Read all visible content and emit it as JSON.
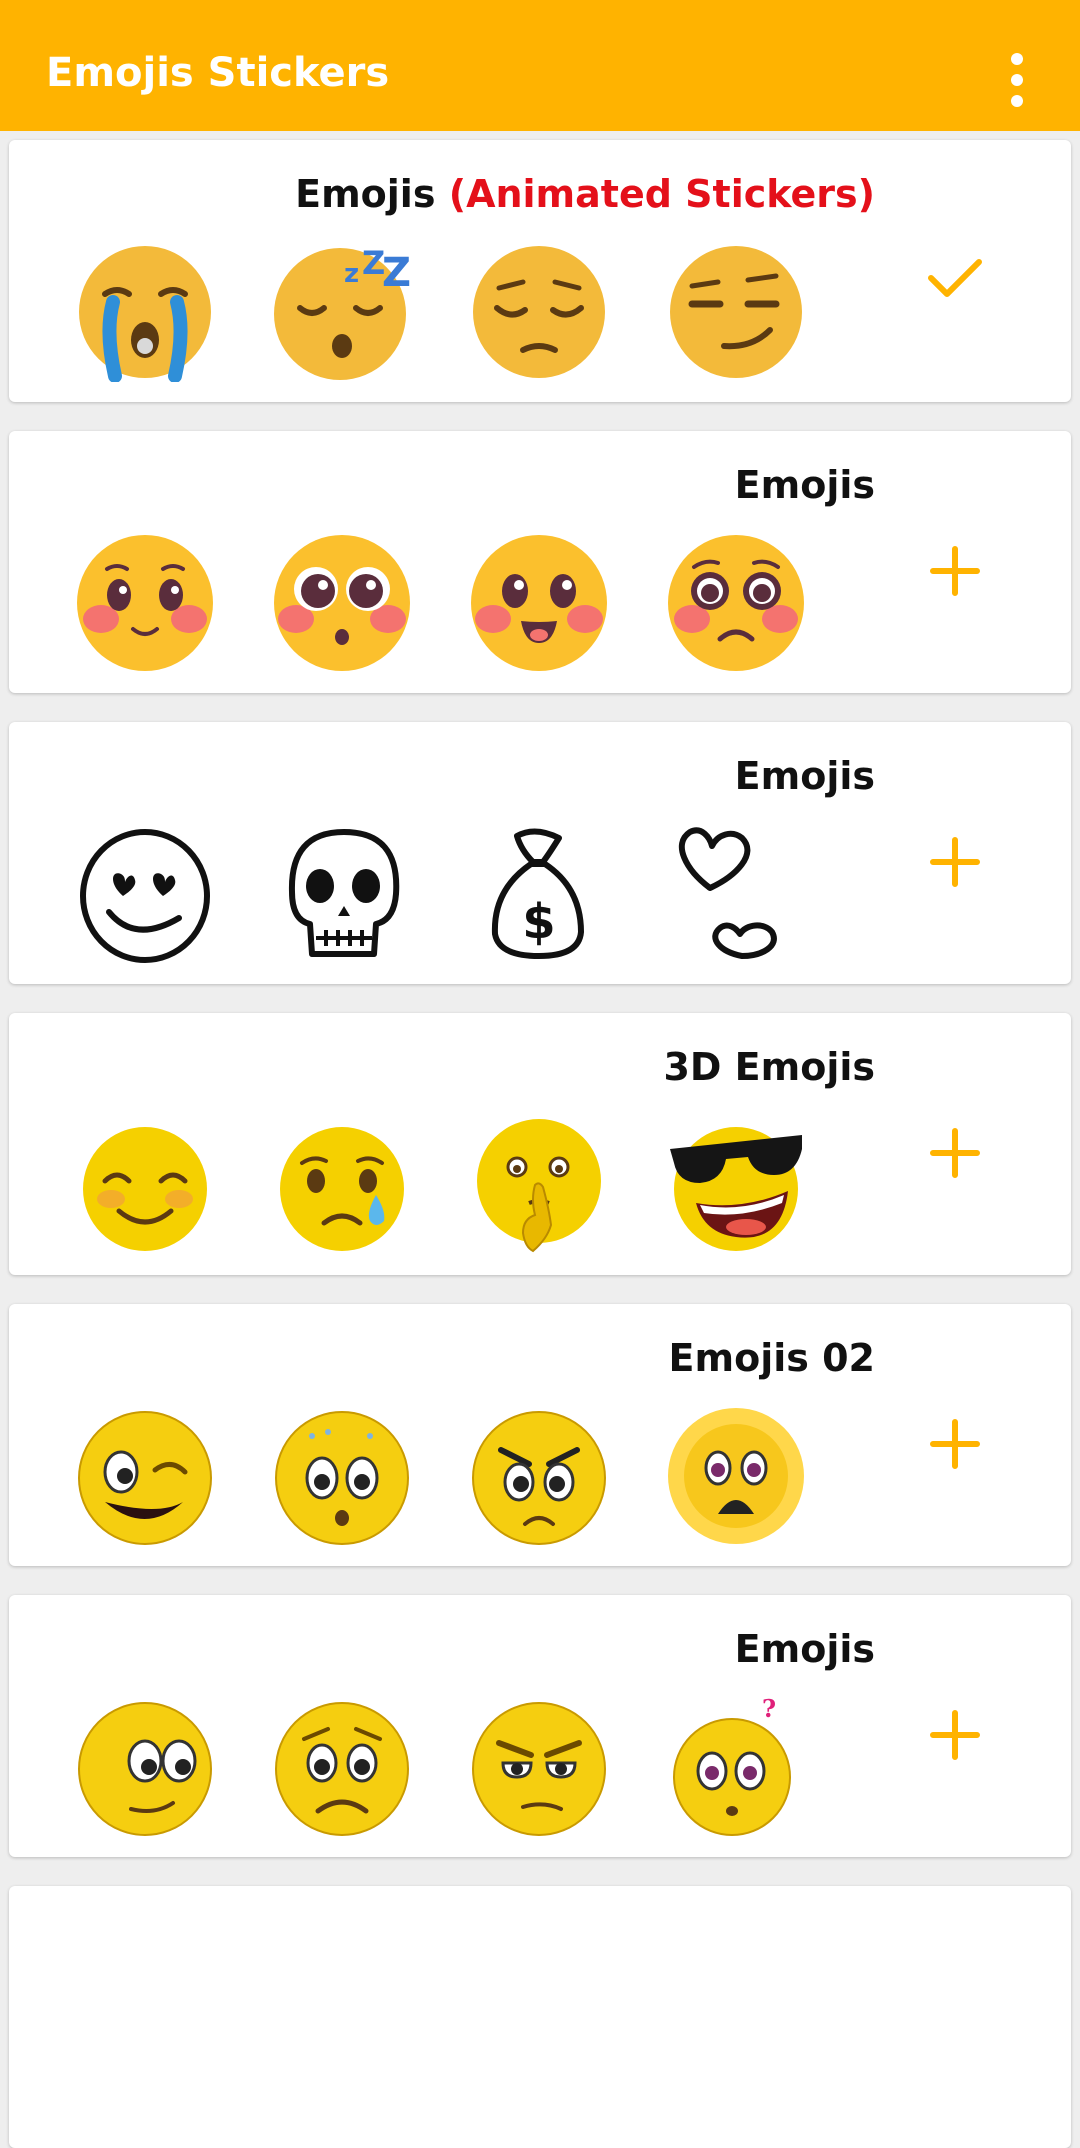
{
  "app": {
    "title": "Emojis Stickers",
    "menu_icon": "more-vert-icon",
    "accent": "#FFB300"
  },
  "packs": [
    {
      "title": "Emojis",
      "title_highlight": "(Animated Stickers)",
      "highlight_color": "#E4101A",
      "action_icon": "check-icon",
      "added": true,
      "stickers": [
        "crying-face",
        "sleeping-face",
        "pensive-face",
        "smirking-face"
      ]
    },
    {
      "title": "Emojis",
      "title_highlight": "",
      "action_icon": "add-icon",
      "added": false,
      "stickers": [
        "blushing-smile",
        "blushing-surprised",
        "blushing-grin",
        "blushing-sad"
      ]
    },
    {
      "title": "Emojis",
      "title_highlight": "",
      "action_icon": "add-icon",
      "added": false,
      "stickers": [
        "heart-eyes-outline",
        "skull-outline",
        "money-bag-outline",
        "hearts-outline"
      ]
    },
    {
      "title": "3D Emojis",
      "title_highlight": "",
      "action_icon": "add-icon",
      "added": false,
      "stickers": [
        "smiling-3d",
        "tear-3d",
        "shush-3d",
        "sunglasses-3d"
      ]
    },
    {
      "title": "Emojis 02",
      "title_highlight": "",
      "action_icon": "add-icon",
      "added": false,
      "stickers": [
        "winking-face",
        "nervous-face",
        "angry-face",
        "shocked-sun-face"
      ]
    },
    {
      "title": "Emojis",
      "title_highlight": "",
      "action_icon": "add-icon",
      "added": false,
      "stickers": [
        "side-eye-face",
        "worried-face",
        "grumpy-face",
        "confused-face"
      ]
    }
  ]
}
